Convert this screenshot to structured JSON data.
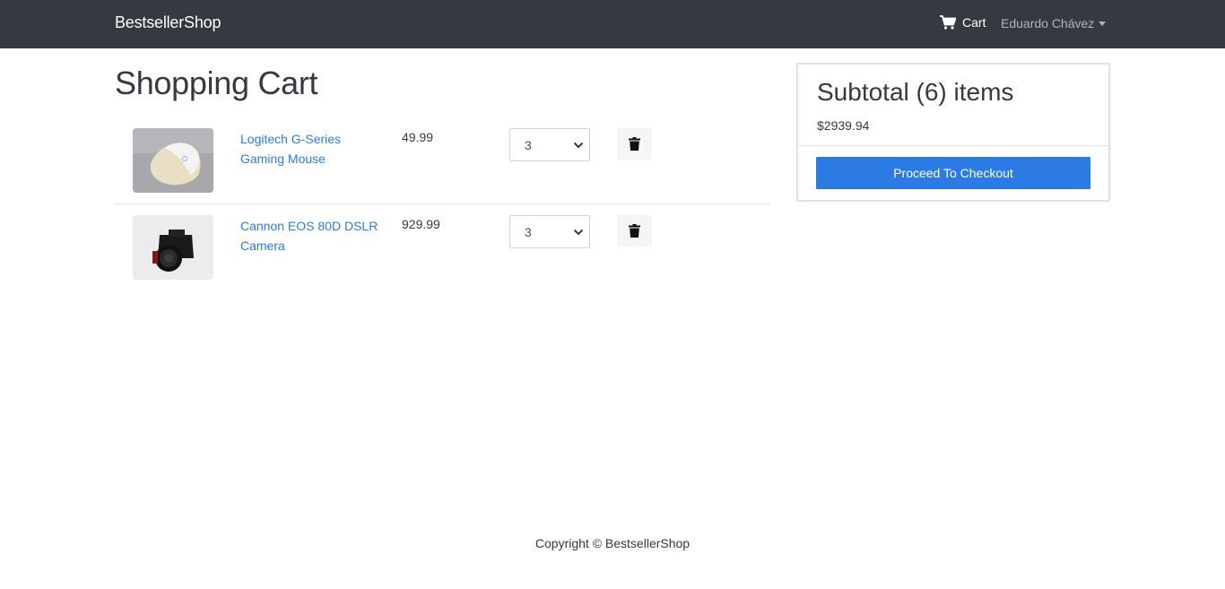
{
  "navbar": {
    "brand": "BestsellerShop",
    "cart_label": "Cart",
    "user_name": "Eduardo Chávez"
  },
  "page_title": "Shopping Cart",
  "cart_items": [
    {
      "name": "Logitech G-Series Gaming Mouse",
      "price": "49.99",
      "quantity": "3",
      "image_icon": "mouse-photo"
    },
    {
      "name": "Cannon EOS 80D DSLR Camera",
      "price": "929.99",
      "quantity": "3",
      "image_icon": "camera-photo"
    }
  ],
  "summary": {
    "title": "Subtotal (6) items",
    "total": "$2939.94",
    "checkout_label": "Proceed To Checkout"
  },
  "footer": {
    "copyright": "Copyright © BestsellerShop"
  },
  "colors": {
    "navbar_bg": "#343a40",
    "accent": "#2c7be5",
    "muted": "#adb5bd"
  }
}
